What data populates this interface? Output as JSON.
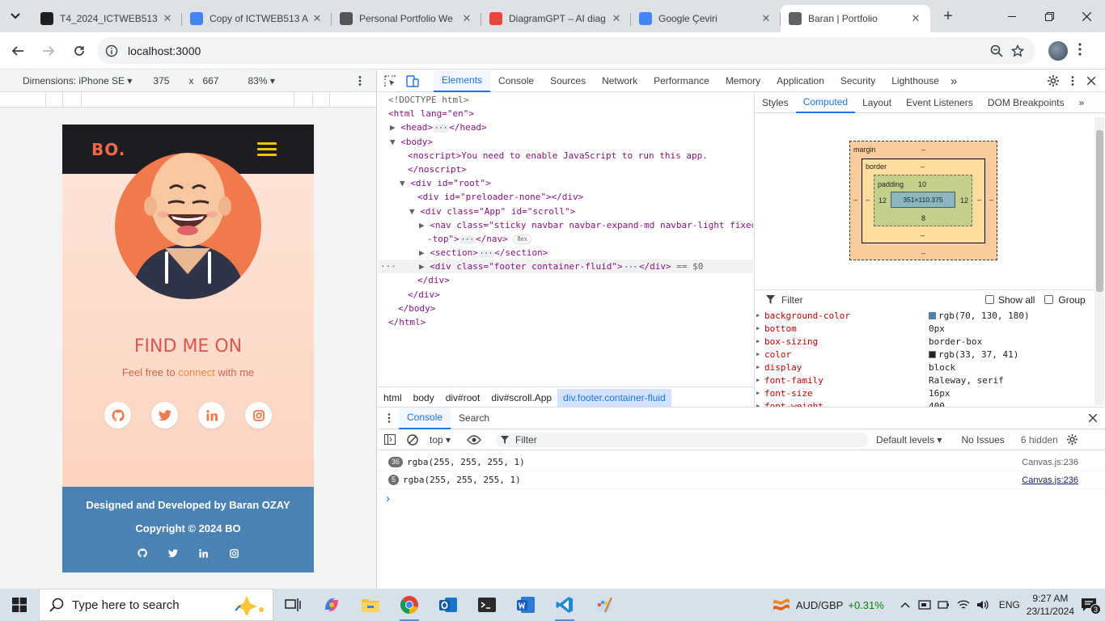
{
  "browser": {
    "tabs": [
      {
        "title": "T4_2024_ICTWEB513",
        "favicon": "in-badge",
        "color": "#1f1f1f"
      },
      {
        "title": "Copy of ICTWEB513 A",
        "favicon": "docs",
        "color": "#4285f4"
      },
      {
        "title": "Personal Portfolio We",
        "favicon": "openai",
        "color": "#555555"
      },
      {
        "title": "DiagramGPT – AI diag",
        "favicon": "eraser",
        "color": "#e8453c"
      },
      {
        "title": "Google Çeviri",
        "favicon": "translate",
        "color": "#4285f4"
      },
      {
        "title": "Baran | Portfolio",
        "favicon": "react",
        "color": "#5f6368",
        "active": true
      }
    ],
    "url": "localhost:3000"
  },
  "device_toolbar": {
    "dimensions": "Dimensions: iPhone SE ▾",
    "width": "375",
    "times": "x",
    "height": "667",
    "zoom": "83% ▾"
  },
  "site": {
    "logo": "BO.",
    "find_title": "FIND ME ON",
    "feel_free_pre": "Feel free to",
    "feel_free_hl": "connect",
    "feel_free_post": "with me",
    "footer_line1": "Designed and Developed by Baran OZAY",
    "footer_line2": "Copyright © 2024 BO",
    "colors": {
      "navbar": "#1c1c22",
      "logo": "#ee6a4f",
      "footer": "#4a82b4",
      "accent": "#f07a4b"
    }
  },
  "devtools": {
    "tabs": [
      "Elements",
      "Console",
      "Sources",
      "Network",
      "Performance",
      "Memory",
      "Application",
      "Security",
      "Lighthouse"
    ],
    "active_tab": "Elements",
    "elements_lines": [
      "<!DOCTYPE html>",
      "<html lang=\"en\">",
      "<head>",
      "<body>",
      "<noscript>You need to enable JavaScript to run this app.",
      "</noscript>",
      "<div id=\"root\">",
      "<div id=\"preloader-none\"></div>",
      "<div class=\"App\" id=\"scroll\">",
      "<nav class=\"sticky navbar navbar-expand-md navbar-light fixed",
      "-top\">",
      "<section>",
      "<div class=\"footer container-fluid\">",
      "</div>",
      "</div>",
      "</body>",
      "</html>"
    ],
    "breadcrumbs": [
      "html",
      "body",
      "div#root",
      "div#scroll.App",
      "div.footer.container-fluid"
    ],
    "styles_tabs": [
      "Styles",
      "Computed",
      "Layout",
      "Event Listeners",
      "DOM Breakpoints"
    ],
    "active_styles_tab": "Computed",
    "box_model": {
      "margin_label": "margin",
      "margin": "–",
      "border_label": "border",
      "border": "–",
      "padding_label": "padding",
      "padding_top": "10",
      "padding_left": "12",
      "padding_right": "12",
      "padding_bottom": "8",
      "content": "351×110.375"
    },
    "filter_placeholder": "Filter",
    "show_all": "Show all",
    "group": "Group",
    "computed": [
      {
        "name": "background-color",
        "value": "rgb(70, 130, 180)",
        "swatch": "#4682b4"
      },
      {
        "name": "bottom",
        "value": "0px"
      },
      {
        "name": "box-sizing",
        "value": "border-box"
      },
      {
        "name": "color",
        "value": "rgb(33, 37, 41)",
        "swatch": "#212529"
      },
      {
        "name": "display",
        "value": "block"
      },
      {
        "name": "font-family",
        "value": "Raleway, serif"
      },
      {
        "name": "font-size",
        "value": "16px"
      },
      {
        "name": "font-weight",
        "value": "400"
      }
    ],
    "drawer_tabs": [
      "Console",
      "Search"
    ],
    "console_context": "top",
    "console_filter": "Filter",
    "default_levels": "Default levels ▾",
    "no_issues": "No Issues",
    "hidden": "6 hidden",
    "messages": [
      {
        "count": "36",
        "text": "rgba(255, 255, 255, 1)",
        "source": "Canvas.js:236"
      },
      {
        "count": "5",
        "text": "rgba(255, 255, 255, 1)",
        "source": "Canvas.js:236"
      }
    ],
    "prompt": "›"
  },
  "taskbar": {
    "search_placeholder": "Type here to search",
    "ticker_label": "AUD/GBP",
    "ticker_change": "+0.31%",
    "lang": "ENG",
    "time": "9:27 AM",
    "date": "23/11/2024",
    "notifications": "3"
  }
}
